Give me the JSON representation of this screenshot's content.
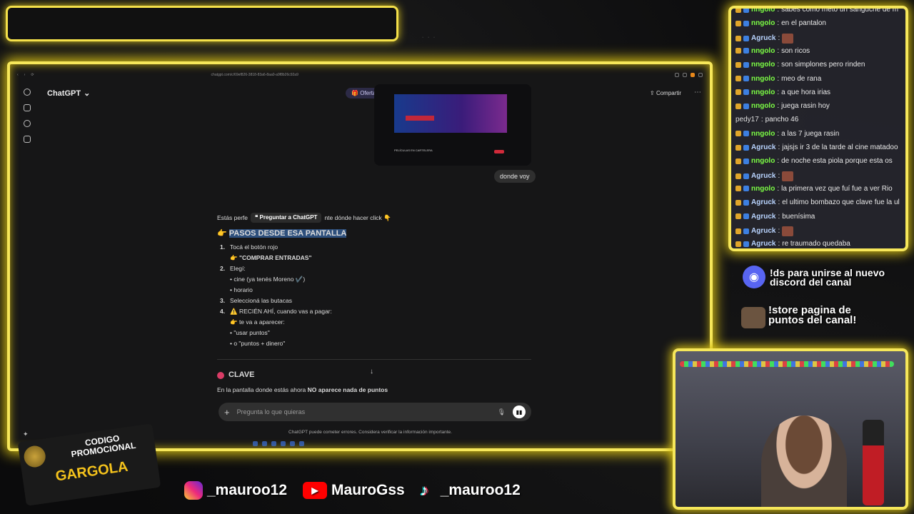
{
  "browser": {
    "url": "chatgpt.com/c/69ef826-3818-83a6-8aa0-a9f8b26c92a9"
  },
  "chatgpt": {
    "title": "ChatGPT",
    "offer": "Oferta gratuita",
    "share": "Compartir",
    "user_message": "donde voy",
    "screenshot_section": "PELÍCULAS EN CARTELERA",
    "intro_start": "Estás perfe",
    "tooltip": "Preguntar a ChatGPT",
    "intro_end": "nte dónde hacer click 👇",
    "heading_emoji": "👉",
    "heading": "PASOS DESDE ESA PANTALLA",
    "steps": [
      {
        "num": "1.",
        "text": "Tocá el botón rojo"
      },
      {
        "text": "👉 \"COMPRAR ENTRADAS\""
      },
      {
        "num": "2.",
        "text": "Elegí:"
      },
      {
        "text": "• cine (ya tenés Moreno ✔️)"
      },
      {
        "text": "• horario"
      },
      {
        "num": "3.",
        "text": "Seleccioná las butacas"
      },
      {
        "num": "4.",
        "text": "⚠️ RECIÉN AHÍ, cuando vas a pagar:"
      },
      {
        "text": "👉 te va a aparecer:"
      },
      {
        "text": "• \"usar puntos\""
      },
      {
        "text": "• o \"puntos + dinero\""
      }
    ],
    "clave_title": "CLAVE",
    "clave_text_start": "En la pantalla donde estás ahora ",
    "clave_text_bold": "NO aparece nada de puntos",
    "composer_placeholder": "Pregunta lo que quieras",
    "disclaimer": "ChatGPT puede cometer errores. Considera verificar la información importante."
  },
  "chat": [
    {
      "user": "nngolo",
      "msg": "sabes como meto un sanguche de m",
      "style": "g"
    },
    {
      "user": "nngolo",
      "msg": "en el pantalon",
      "style": "g"
    },
    {
      "user": "Agruck",
      "msg": "",
      "style": "w",
      "emote": true
    },
    {
      "user": "nngolo",
      "msg": "son ricos",
      "style": "g"
    },
    {
      "user": "nngolo",
      "msg": "son simplones pero rinden",
      "style": "g"
    },
    {
      "user": "nngolo",
      "msg": "meo de rana",
      "style": "g"
    },
    {
      "user": "nngolo",
      "msg": "a que hora irias",
      "style": "g"
    },
    {
      "user": "nngolo",
      "msg": "juega rasin hoy",
      "style": "g"
    },
    {
      "user": "pedy17",
      "msg": "pancho 46",
      "style": "p"
    },
    {
      "user": "nngolo",
      "msg": "a las 7 juega rasin",
      "style": "g"
    },
    {
      "user": "Agruck",
      "msg": "jajsjs ir 3 de la tarde al cine matadoo",
      "style": "w"
    },
    {
      "user": "nngolo",
      "msg": "de noche esta piola porque esta os",
      "style": "g"
    },
    {
      "user": "Agruck",
      "msg": "",
      "style": "w",
      "emote": true
    },
    {
      "user": "nngolo",
      "msg": "la primera vez que fuí fue a ver Rio",
      "style": "g"
    },
    {
      "user": "Agruck",
      "msg": "el ultimo bombazo que clave fue la ul",
      "style": "w"
    },
    {
      "user": "Agruck",
      "msg": "buenísima",
      "style": "w"
    },
    {
      "user": "Agruck",
      "msg": "",
      "style": "w",
      "emote": true
    },
    {
      "user": "Agruck",
      "msg": "re traumado quedaba",
      "style": "w"
    }
  ],
  "promos": {
    "discord": "!ds para unirse al nuevo discord del canal",
    "discord_l1": "!ds para unirse al nuevo",
    "discord_l2": "discord del canal",
    "store_l1": "!store pagina de",
    "store_l2": "puntos del canal!"
  },
  "logo": {
    "line1": "CODIGO",
    "line2": "PROMOCIONAL",
    "name": "GARGOLA"
  },
  "socials": {
    "instagram": "_mauroo12",
    "youtube": "MauroGss",
    "tiktok": "_mauroo12"
  },
  "colors": {
    "neon": "#f6e75a",
    "chat_green": "#7dff45",
    "discord": "#5865f2"
  }
}
